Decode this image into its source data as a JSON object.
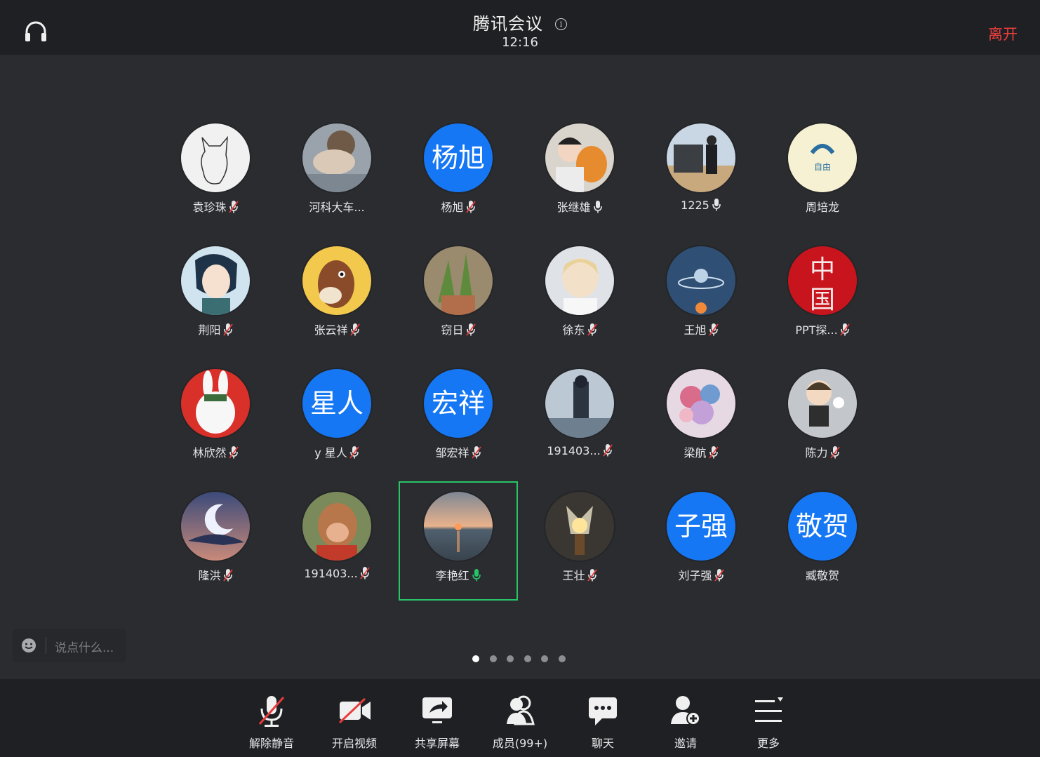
{
  "header": {
    "title": "腾讯会议",
    "time": "12:16",
    "leave_label": "离开"
  },
  "participants": [
    {
      "name": "袁珍珠",
      "mic": "muted",
      "avatar": "photo"
    },
    {
      "name": "河科大车...",
      "mic": "none",
      "avatar": "photo"
    },
    {
      "name": "杨旭",
      "mic": "muted",
      "avatar": "text",
      "avatar_text": "杨旭"
    },
    {
      "name": "张继雄",
      "mic": "on",
      "avatar": "photo"
    },
    {
      "name": "1225",
      "mic": "on",
      "avatar": "photo"
    },
    {
      "name": "周培龙",
      "mic": "none",
      "avatar": "photo"
    },
    {
      "name": "荆阳",
      "mic": "muted",
      "avatar": "photo"
    },
    {
      "name": "张云祥",
      "mic": "muted",
      "avatar": "photo"
    },
    {
      "name": "窃日",
      "mic": "muted",
      "avatar": "photo"
    },
    {
      "name": "徐东",
      "mic": "muted",
      "avatar": "photo"
    },
    {
      "name": "王旭",
      "mic": "muted",
      "avatar": "photo"
    },
    {
      "name": "PPT探...",
      "mic": "muted",
      "avatar": "photo"
    },
    {
      "name": "林欣然",
      "mic": "muted",
      "avatar": "photo"
    },
    {
      "name": "y 星人",
      "mic": "muted",
      "avatar": "text",
      "avatar_text": "星人"
    },
    {
      "name": "邹宏祥",
      "mic": "muted",
      "avatar": "text",
      "avatar_text": "宏祥"
    },
    {
      "name": "191403...",
      "mic": "muted",
      "avatar": "photo"
    },
    {
      "name": "梁航",
      "mic": "muted",
      "avatar": "photo"
    },
    {
      "name": "陈力",
      "mic": "muted",
      "avatar": "photo"
    },
    {
      "name": "隆洪",
      "mic": "muted",
      "avatar": "photo"
    },
    {
      "name": "191403...",
      "mic": "muted",
      "avatar": "photo"
    },
    {
      "name": "李艳红",
      "mic": "speaking",
      "avatar": "photo",
      "selected": true
    },
    {
      "name": "王壮",
      "mic": "muted",
      "avatar": "photo"
    },
    {
      "name": "刘子强",
      "mic": "muted",
      "avatar": "text",
      "avatar_text": "子强"
    },
    {
      "name": "臧敬贺",
      "mic": "none",
      "avatar": "text",
      "avatar_text": "敬贺"
    }
  ],
  "chat": {
    "placeholder": "说点什么..."
  },
  "pagination": {
    "pages": 6,
    "current": 1
  },
  "toolbar": [
    {
      "id": "unmute",
      "label": "解除静音",
      "icon": "mic-muted-icon"
    },
    {
      "id": "video",
      "label": "开启视频",
      "icon": "video-off-icon"
    },
    {
      "id": "share",
      "label": "共享屏幕",
      "icon": "share-screen-icon"
    },
    {
      "id": "members",
      "label": "成员(99+)",
      "icon": "members-icon"
    },
    {
      "id": "chat",
      "label": "聊天",
      "icon": "chat-icon"
    },
    {
      "id": "invite",
      "label": "邀请",
      "icon": "invite-icon"
    },
    {
      "id": "more",
      "label": "更多",
      "icon": "more-icon"
    }
  ],
  "colors": {
    "accent_blue": "#1577f4",
    "leave_red": "#ee3e3e",
    "speaking_green": "#27c468"
  }
}
